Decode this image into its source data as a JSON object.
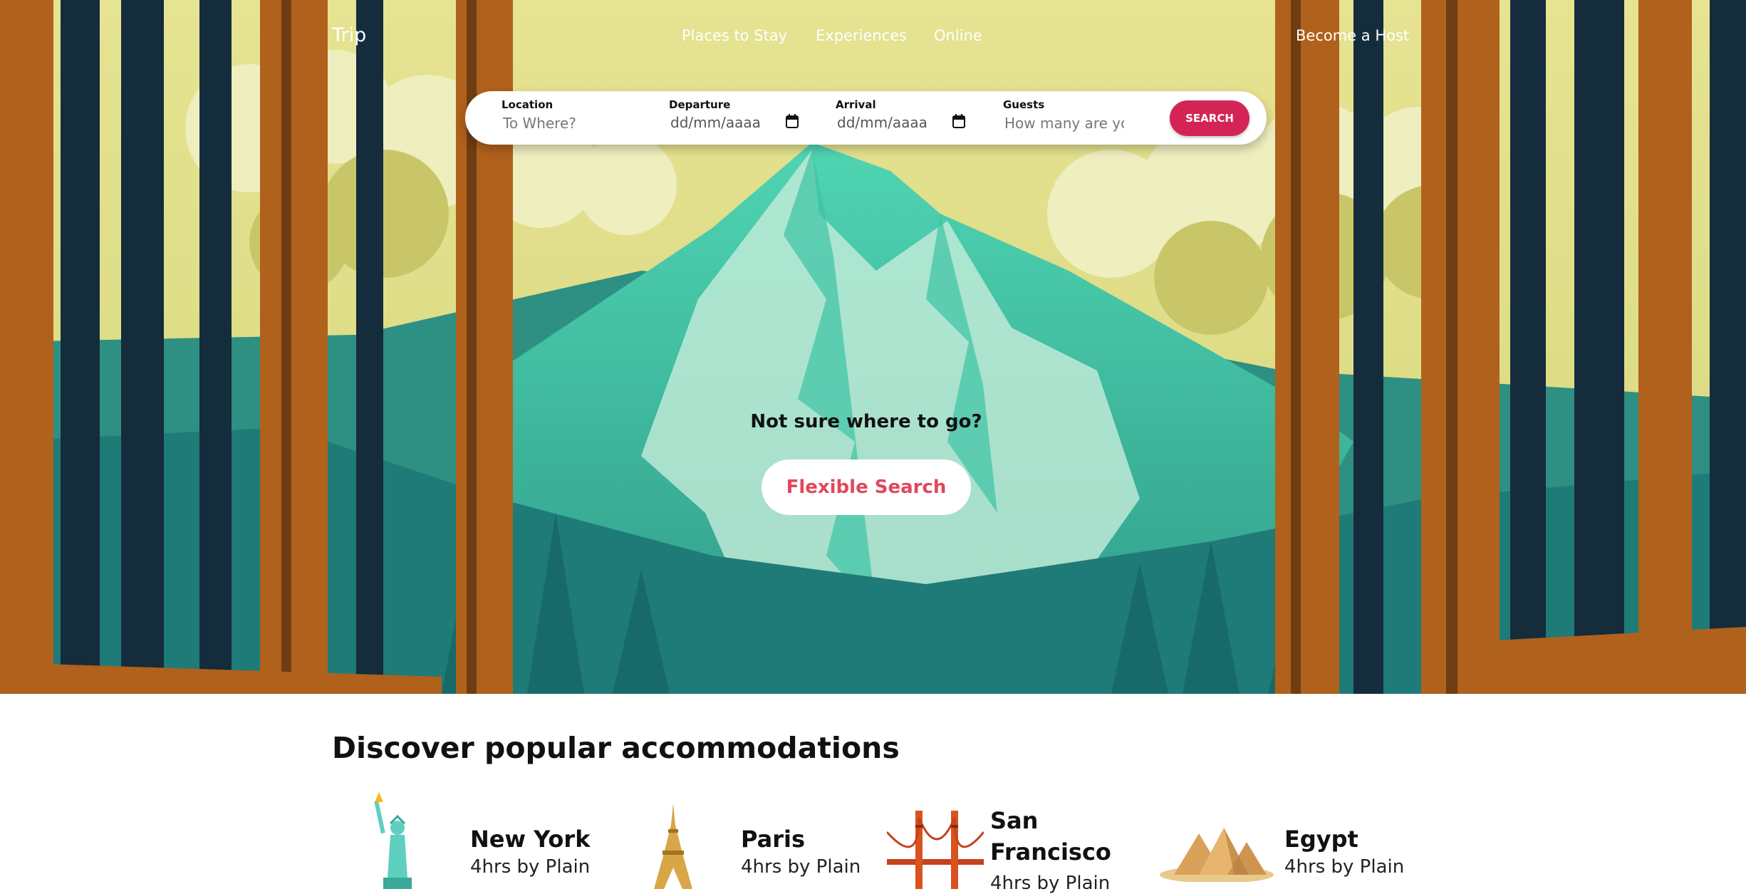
{
  "nav": {
    "brand": "Trip",
    "links": [
      "Places to Stay",
      "Experiences",
      "Online"
    ],
    "host_link": "Become a Host"
  },
  "search": {
    "location_label": "Location",
    "location_placeholder": "To Where?",
    "departure_label": "Departure",
    "departure_placeholder": "dd/mm/aaaa",
    "arrival_label": "Arrival",
    "arrival_placeholder": "dd/mm/aaaa",
    "guests_label": "Guests",
    "guests_placeholder": "How many are yo",
    "button_label": "SEARCH"
  },
  "hero": {
    "question": "Not sure where to go?",
    "flexible_button": "Flexible Search"
  },
  "accommodations": {
    "title": "Discover popular accommodations",
    "items": [
      {
        "name": "New York",
        "travel": "4hrs by Plain",
        "icon": "statue-of-liberty-icon"
      },
      {
        "name": "Paris",
        "travel": "4hrs by Plain",
        "icon": "eiffel-tower-icon"
      },
      {
        "name": "San Francisco",
        "travel": "4hrs by Plain",
        "icon": "golden-gate-bridge-icon"
      },
      {
        "name": "Egypt",
        "travel": "4hrs by Plain",
        "icon": "pyramids-icon"
      }
    ]
  },
  "colors": {
    "accent": "#d42456",
    "flexible_text": "#e0485b",
    "sky": "#e0df88",
    "mountain": "#2f9e8c",
    "trunk": "#b0611c",
    "dark_trunk": "#142c3b"
  }
}
